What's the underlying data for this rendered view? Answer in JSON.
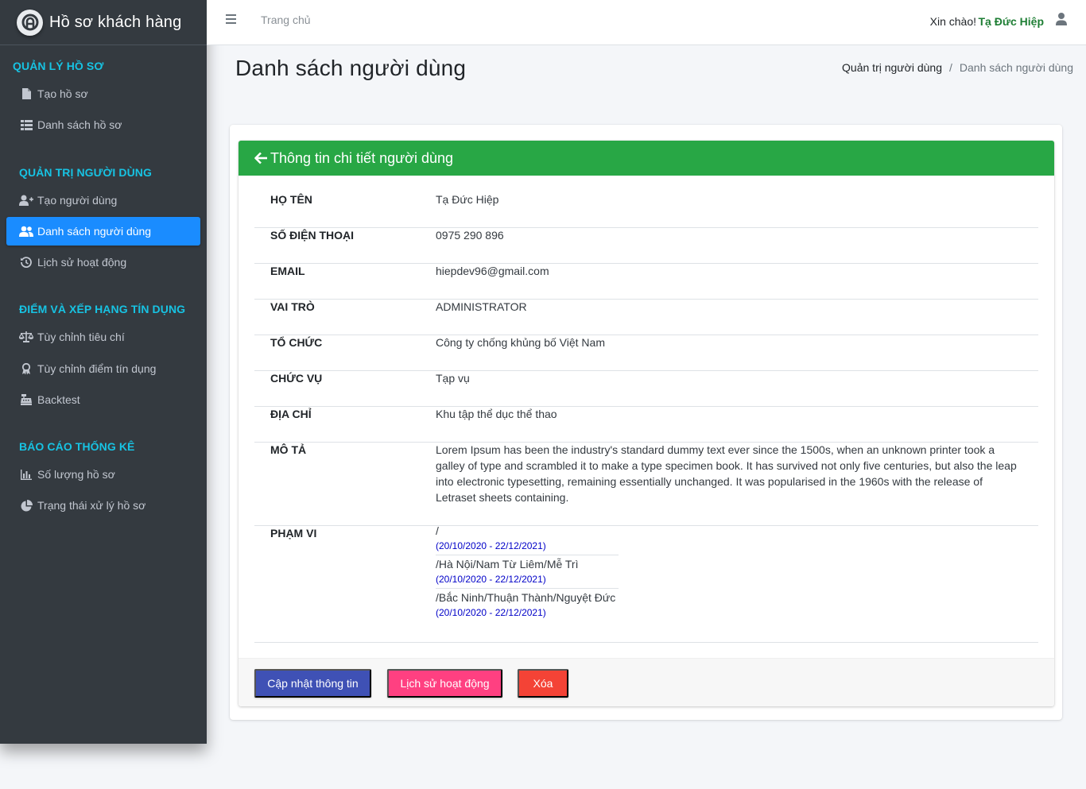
{
  "sidebar": {
    "brand": "Hồ sơ khách hàng",
    "sections": [
      {
        "header": "QUẢN LÝ HỒ SƠ",
        "items": [
          {
            "label": "Tạo hồ sơ",
            "icon": "file-icon"
          },
          {
            "label": "Danh sách hồ sơ",
            "icon": "list-icon"
          }
        ]
      },
      {
        "header": "QUẢN TRỊ NGƯỜI DÙNG",
        "items": [
          {
            "label": "Tạo người dùng",
            "icon": "user-plus-icon"
          },
          {
            "label": "Danh sách người dùng",
            "icon": "users-icon",
            "active": true
          },
          {
            "label": "Lịch sử hoạt động",
            "icon": "history-icon"
          }
        ]
      },
      {
        "header": "ĐIỂM VÀ XẾP HẠNG TÍN DỤNG",
        "items": [
          {
            "label": "Tùy chỉnh tiêu chí",
            "icon": "balance-scale-icon"
          },
          {
            "label": "Tùy chỉnh điểm tín dụng",
            "icon": "award-icon"
          },
          {
            "label": "Backtest",
            "icon": "cash-register-icon"
          }
        ]
      },
      {
        "header": "BÁO CÁO THỐNG KÊ",
        "items": [
          {
            "label": "Số lượng hồ sơ",
            "icon": "bar-chart-icon"
          },
          {
            "label": "Trạng thái xử lý hồ sơ",
            "icon": "pie-chart-icon"
          }
        ]
      }
    ]
  },
  "topbar": {
    "home": "Trang chủ",
    "greeting": "Xin chào!",
    "user_name": "Tạ Đức Hiệp"
  },
  "page": {
    "title": "Danh sách người dùng",
    "breadcrumb": [
      "Quản trị người dùng",
      "Danh sách người dùng"
    ],
    "breadcrumb_separator": "/"
  },
  "card": {
    "title": "Thông tin chi tiết người dùng",
    "fields": [
      {
        "label": "HỌ TÊN",
        "value": "Tạ Đức Hiệp"
      },
      {
        "label": "SỐ ĐIỆN THOẠI",
        "value": "0975 290 896"
      },
      {
        "label": "EMAIL",
        "value": "hiepdev96@gmail.com"
      },
      {
        "label": "VAI TRÒ",
        "value": "ADMINISTRATOR"
      },
      {
        "label": "TỔ CHỨC",
        "value": "Công ty chống khủng bố Việt Nam"
      },
      {
        "label": "CHỨC VỤ",
        "value": "Tạp vụ"
      },
      {
        "label": "ĐỊA CHỈ",
        "value": "Khu tập thể dục thể thao"
      },
      {
        "label": "MÔ TẢ",
        "value": "Lorem Ipsum has been the industry's standard dummy text ever since the 1500s, when an unknown printer took a galley of type and scrambled it to make a type specimen book. It has survived not only five centuries, but also the leap into electronic typesetting, remaining essentially unchanged. It was popularised in the 1960s with the release of Letraset sheets containing."
      }
    ],
    "scope_label": "PHẠM VI",
    "scope": [
      {
        "path": "/",
        "date": "(20/10/2020 - 22/12/2021)"
      },
      {
        "path": "/Hà Nội/Nam Từ Liêm/Mễ Trì",
        "date": "(20/10/2020 - 22/12/2021)"
      },
      {
        "path": "/Bắc Ninh/Thuận Thành/Nguyệt Đức",
        "date": "(20/10/2020 - 22/12/2021)"
      }
    ],
    "buttons": {
      "update": "Cập nhật thông tin",
      "history": "Lịch sử hoạt động",
      "delete": "Xóa"
    }
  },
  "colors": {
    "sidebar_bg": "#343a40",
    "section_header": "#17c3e3",
    "active_item": "#1a8cff",
    "card_header": "#28a745",
    "user_name": "#1e7e34",
    "btn_update": "#3f51b5",
    "btn_history": "#ff4081",
    "btn_delete": "#f44336"
  }
}
